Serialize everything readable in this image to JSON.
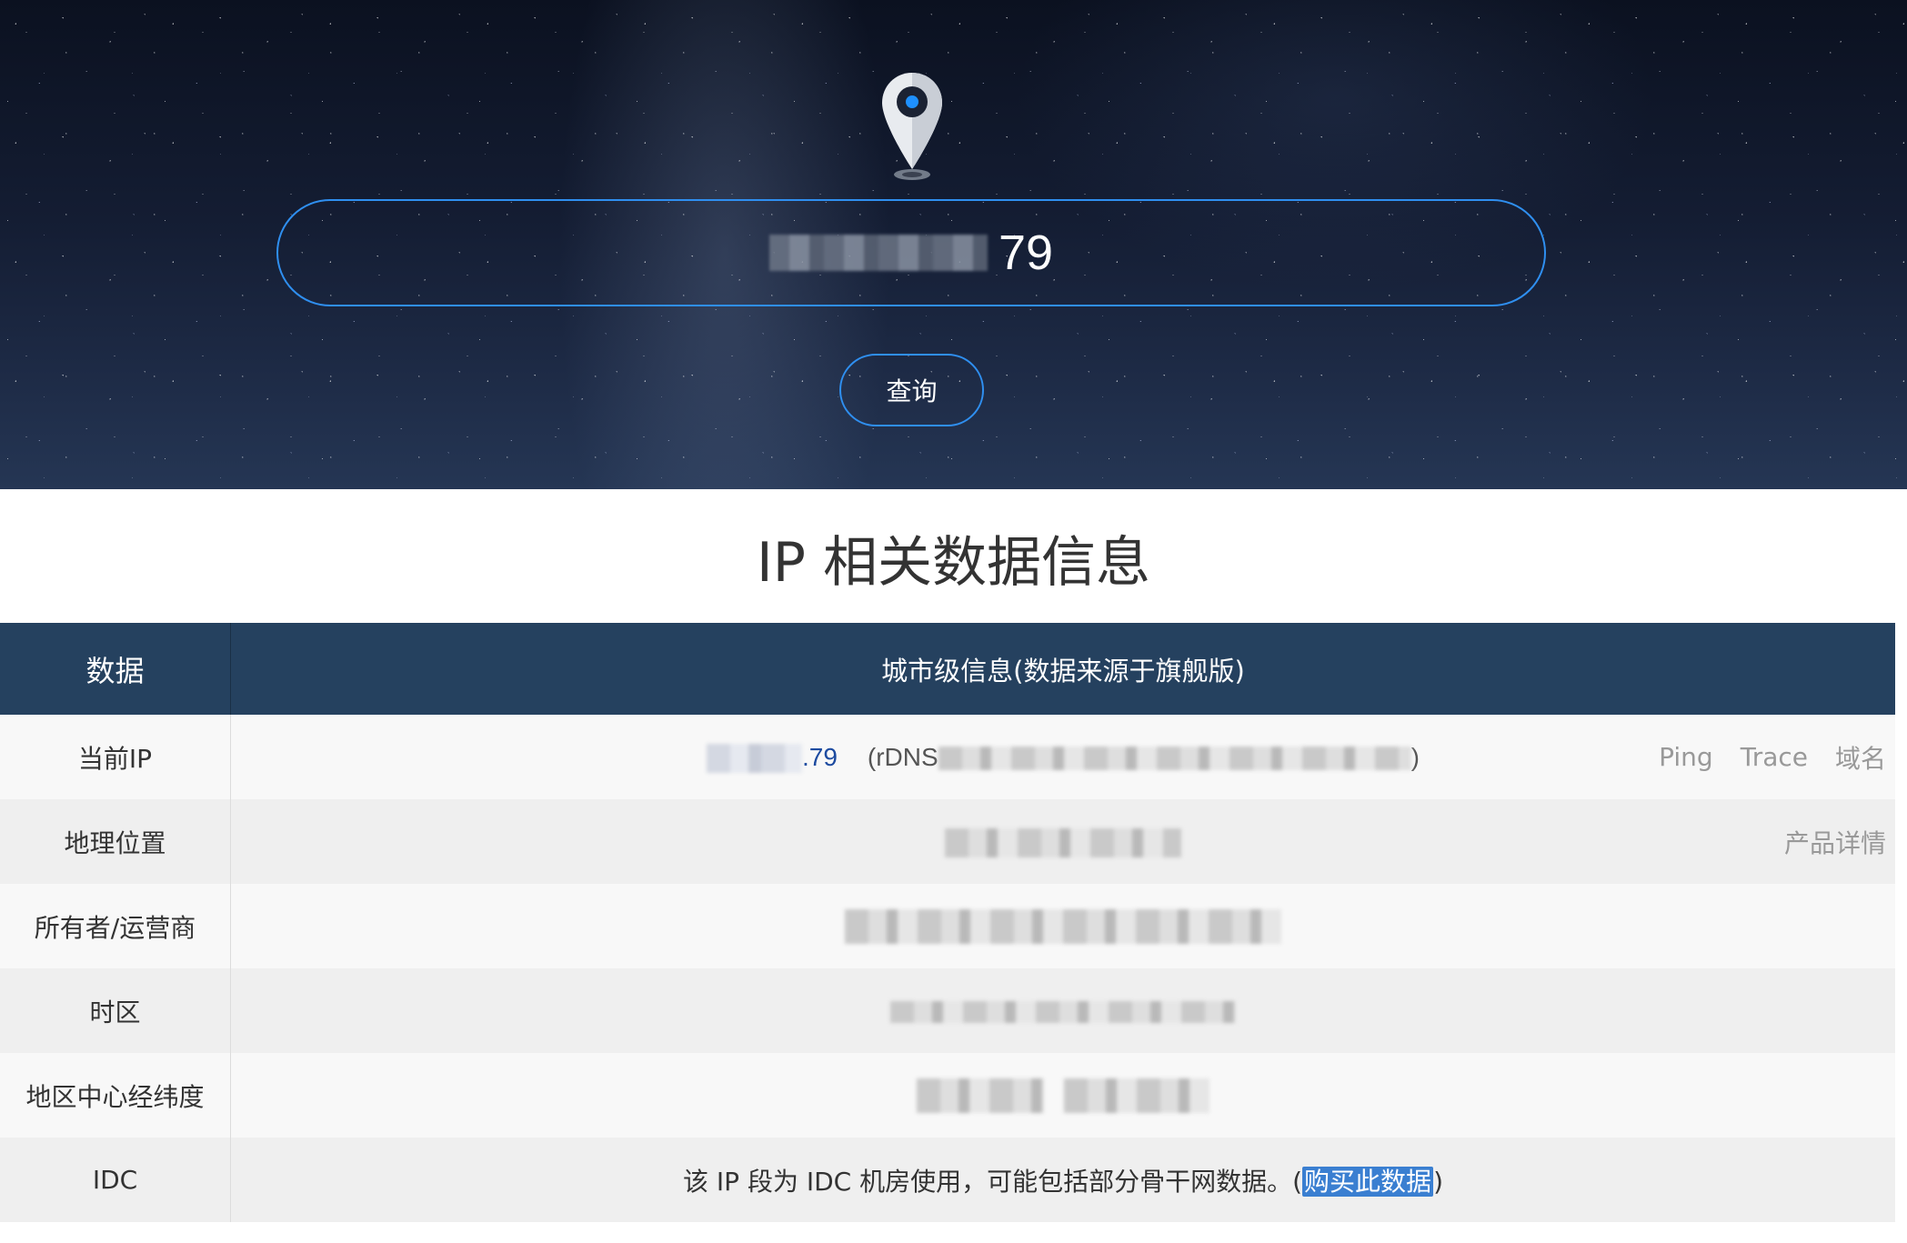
{
  "search": {
    "ip_visible_suffix": "79",
    "query_button": "查询"
  },
  "section_title": "IP 相关数据信息",
  "table": {
    "headers": [
      "数据",
      "城市级信息(数据来源于旗舰版)"
    ],
    "rows": [
      {
        "label": "当前IP",
        "ip_suffix": ".79",
        "rdns_label": "(rDNS",
        "rdns_close": ")",
        "links": [
          "Ping",
          "Trace",
          "域名"
        ]
      },
      {
        "label": "地理位置",
        "links": [
          "产品详情"
        ]
      },
      {
        "label": "所有者/运营商"
      },
      {
        "label": "时区"
      },
      {
        "label": "地区中心经纬度"
      },
      {
        "label": "IDC",
        "text_before": "该 IP 段为 IDC 机房使用，可能包括部分骨干网数据。(",
        "link": "购买此数据",
        "text_after": ")"
      }
    ]
  },
  "colors": {
    "accent": "#2f8ff0",
    "header_bg": "#25415f",
    "link_highlight": "#3a7fd1"
  }
}
